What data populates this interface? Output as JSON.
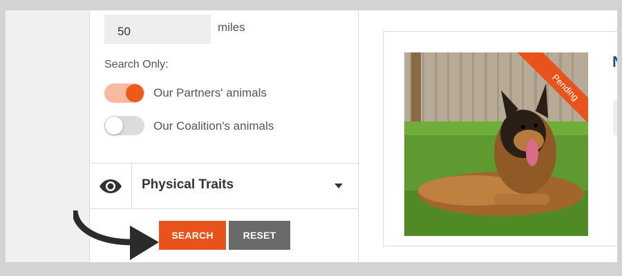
{
  "filters": {
    "distance": {
      "value": "50",
      "unit": "miles"
    },
    "search_only_label": "Search Only:",
    "toggles": [
      {
        "label": "Our Partners' animals",
        "state": "on"
      },
      {
        "label": "Our Coalition's animals",
        "state": "off"
      }
    ],
    "physical_traits": {
      "label": "Physical Traits",
      "icon": "eye-icon"
    },
    "buttons": {
      "search": "SEARCH",
      "reset": "RESET"
    }
  },
  "card": {
    "status_ribbon": "Pending",
    "title_initial": "N"
  },
  "colors": {
    "accent": "#e8531c",
    "reset": "#6a6a6a",
    "title_blue": "#1f4e8c"
  }
}
